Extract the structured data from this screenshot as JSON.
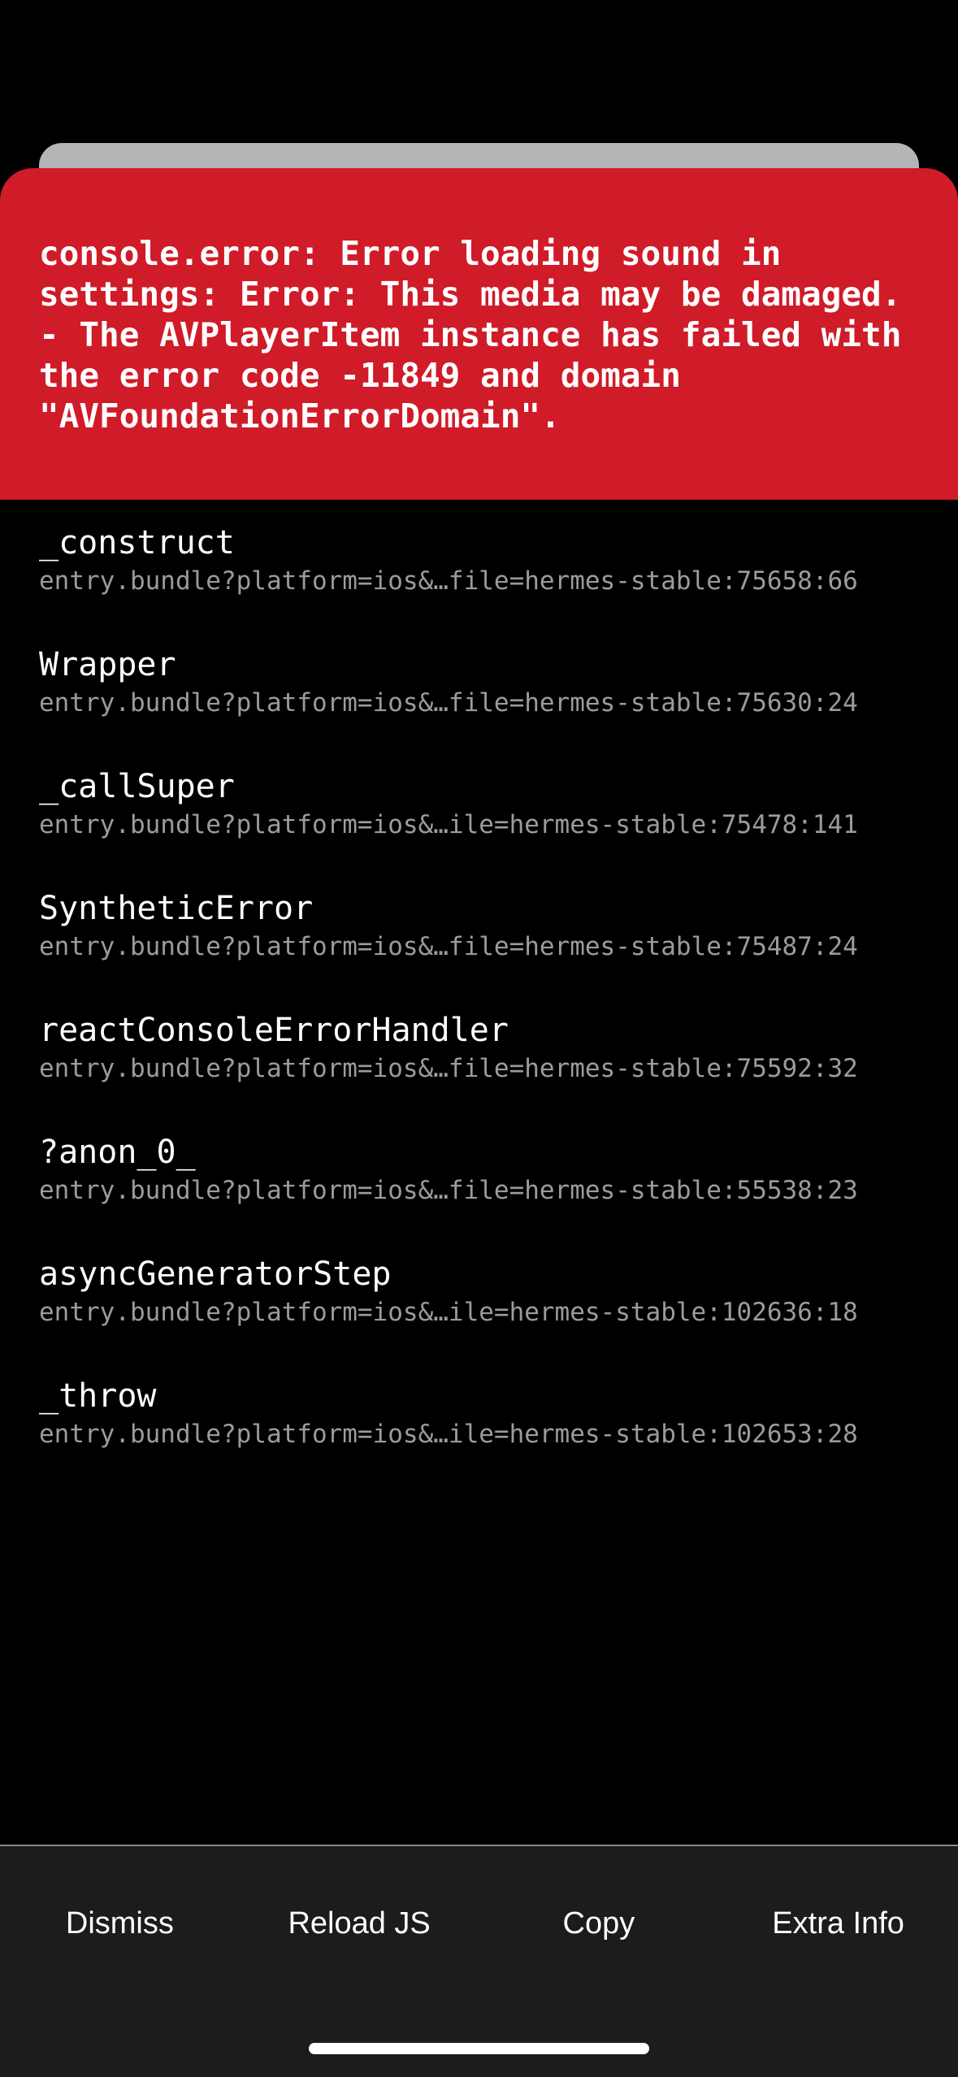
{
  "error": {
    "message": "console.error: Error loading sound in settings: Error: This media may be damaged. - The AVPlayerItem instance has failed with the error code -11849 and domain \"AVFoundationErrorDomain\"."
  },
  "stack": [
    {
      "method": "_construct",
      "location": "entry.bundle?platform=ios&…file=hermes-stable:75658:66"
    },
    {
      "method": "Wrapper",
      "location": "entry.bundle?platform=ios&…file=hermes-stable:75630:24"
    },
    {
      "method": "_callSuper",
      "location": "entry.bundle?platform=ios&…ile=hermes-stable:75478:141"
    },
    {
      "method": "SyntheticError",
      "location": "entry.bundle?platform=ios&…file=hermes-stable:75487:24"
    },
    {
      "method": "reactConsoleErrorHandler",
      "location": "entry.bundle?platform=ios&…file=hermes-stable:75592:32"
    },
    {
      "method": "?anon_0_",
      "location": "entry.bundle?platform=ios&…file=hermes-stable:55538:23"
    },
    {
      "method": "asyncGeneratorStep",
      "location": "entry.bundle?platform=ios&…ile=hermes-stable:102636:18"
    },
    {
      "method": "_throw",
      "location": "entry.bundle?platform=ios&…ile=hermes-stable:102653:28"
    }
  ],
  "footer": {
    "dismiss_label": "Dismiss",
    "reload_label": "Reload JS",
    "copy_label": "Copy",
    "extra_info_label": "Extra Info"
  },
  "colors": {
    "error_red": "#d01b28",
    "background": "#000000",
    "footer_bg": "#1c1c1c",
    "location_gray": "#9b9b9b"
  }
}
